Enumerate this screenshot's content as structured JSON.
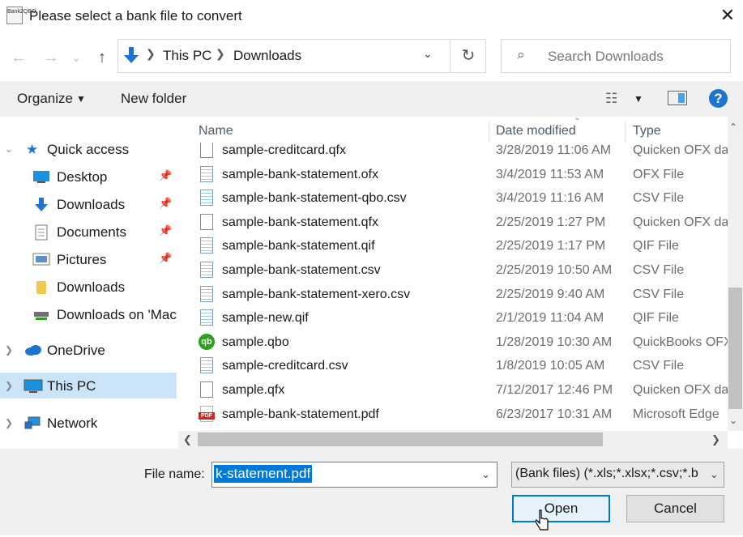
{
  "window": {
    "app_icon_text": "Bank2QBO",
    "title": "Please select a bank file to convert",
    "close_symbol": "✕"
  },
  "nav": {
    "back_symbol": "←",
    "forward_symbol": "→",
    "recent_symbol": "⌄",
    "up_symbol": "↑",
    "breadcrumb": [
      "This PC",
      "Downloads"
    ],
    "refresh_symbol": "↻",
    "search_placeholder": "Search Downloads"
  },
  "toolbar": {
    "organize_label": "Organize",
    "new_folder_label": "New folder",
    "help_label": "?"
  },
  "navpane": {
    "items": [
      {
        "label": "Quick access",
        "icon": "star-icon"
      },
      {
        "label": "Desktop",
        "icon": "desktop-folder-icon",
        "pinned": true
      },
      {
        "label": "Downloads",
        "icon": "downloads-folder-icon",
        "pinned": true
      },
      {
        "label": "Documents",
        "icon": "documents-folder-icon",
        "pinned": true
      },
      {
        "label": "Pictures",
        "icon": "pictures-folder-icon",
        "pinned": true
      },
      {
        "label": "Downloads",
        "icon": "folder-icon"
      },
      {
        "label": "Downloads on 'Mac",
        "icon": "network-drive-icon"
      },
      {
        "label": "OneDrive",
        "icon": "cloud-icon"
      },
      {
        "label": "This PC",
        "icon": "computer-icon",
        "selected": true
      },
      {
        "label": "Network",
        "icon": "network-icon"
      }
    ]
  },
  "filelist": {
    "columns": [
      "Name",
      "Date modified",
      "Type"
    ],
    "rows": [
      {
        "name": "sample-creditcard.qfx",
        "date": "3/28/2019 11:06 AM",
        "type": "Quicken OFX data",
        "icon": "blank-file-icon"
      },
      {
        "name": "sample-bank-statement.ofx",
        "date": "3/4/2019 11:53 AM",
        "type": "OFX File",
        "icon": "data-file-icon"
      },
      {
        "name": "sample-bank-statement-qbo.csv",
        "date": "3/4/2019 11:16 AM",
        "type": "CSV File",
        "icon": "data-file-icon"
      },
      {
        "name": "sample-bank-statement.qfx",
        "date": "2/25/2019 1:27 PM",
        "type": "Quicken OFX data",
        "icon": "blank-file-icon"
      },
      {
        "name": "sample-bank-statement.qif",
        "date": "2/25/2019 1:17 PM",
        "type": "QIF File",
        "icon": "data-file-icon"
      },
      {
        "name": "sample-bank-statement.csv",
        "date": "2/25/2019 10:50 AM",
        "type": "CSV File",
        "icon": "data-file-icon"
      },
      {
        "name": "sample-bank-statement-xero.csv",
        "date": "2/25/2019 9:40 AM",
        "type": "CSV File",
        "icon": "data-file-icon"
      },
      {
        "name": "sample-new.qif",
        "date": "2/1/2019 11:04 AM",
        "type": "QIF File",
        "icon": "data-file-icon"
      },
      {
        "name": "sample.qbo",
        "date": "1/28/2019 10:30 AM",
        "type": "QuickBooks OFX",
        "icon": "quickbooks-icon"
      },
      {
        "name": "sample-creditcard.csv",
        "date": "1/8/2019 10:05 AM",
        "type": "CSV File",
        "icon": "data-file-icon"
      },
      {
        "name": "sample.qfx",
        "date": "7/12/2017 12:46 PM",
        "type": "Quicken OFX data",
        "icon": "blank-file-icon"
      },
      {
        "name": "sample-bank-statement.pdf",
        "date": "6/23/2017 10:31 AM",
        "type": "Microsoft Edge",
        "icon": "pdf-icon"
      }
    ]
  },
  "footer": {
    "file_name_label": "File name:",
    "file_name_value": "k-statement.pdf",
    "filter_value": "(Bank files) (*.xls;*.xlsx;*.csv;*.b",
    "open_label": "Open",
    "cancel_label": "Cancel"
  },
  "colors": {
    "accent": "#0078d7",
    "selection": "#cce4f7",
    "toolbar_bg": "#f0f0f0",
    "quickbooks_green": "#2ca01c",
    "pdf_red": "#d9251c"
  }
}
